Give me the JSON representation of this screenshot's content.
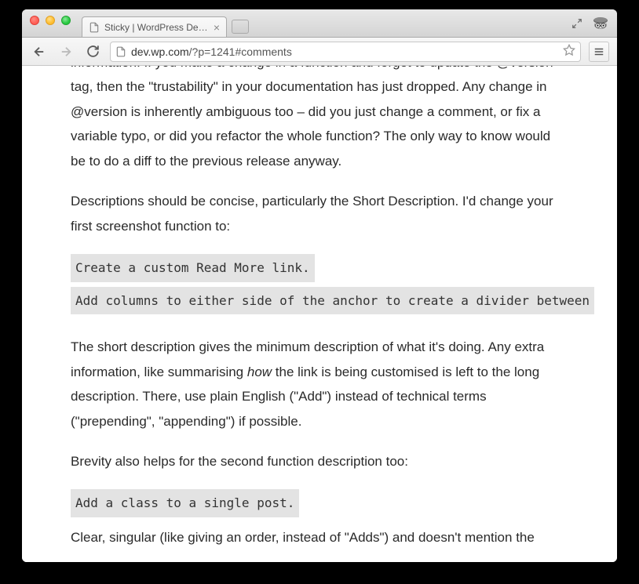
{
  "browser": {
    "tab_title": "Sticky | WordPress Develop",
    "url_domain": "dev.wp.com",
    "url_path": "/?p=1241#comments"
  },
  "article": {
    "p1": "information. If you make a change in a function and forget to update the @version tag, then the \"trustability\" in your documentation has just dropped. Any change in @version is inherently ambiguous too – did you just change a comment, or fix a variable typo, or did you refactor the whole function? The only way to know would be to do a diff to the previous release anyway.",
    "p2": "Descriptions should be concise, particularly the Short Description. I'd change your first screenshot function to:",
    "code1": "Create a custom Read More link.",
    "code2": "Add columns to either side of the anchor to create a divider between",
    "p3_a": "The short description gives the minimum description of what it's doing. Any extra information, like summarising ",
    "p3_how": "how",
    "p3_b": " the link is being customised is left to the long description. There, use plain English (\"Add\") instead of technical terms (\"prepending\", \"appending\") if possible.",
    "p4": "Brevity also helps for the second function description too:",
    "code3": "Add a class to a single post.",
    "p5": "Clear, singular (like giving an order, instead of \"Adds\") and doesn't mention the"
  }
}
